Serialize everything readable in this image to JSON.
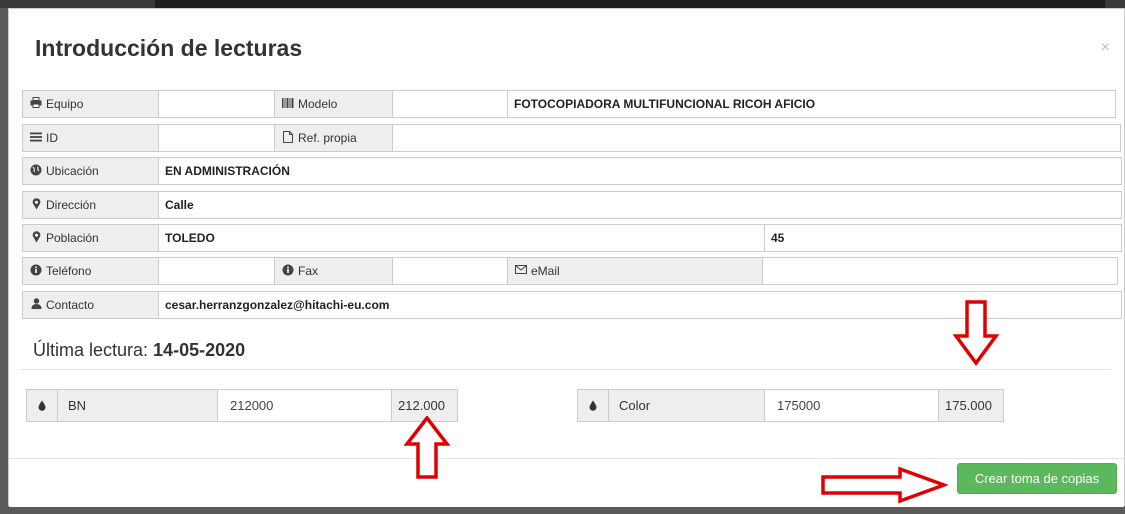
{
  "modal": {
    "title": "Introducción de lecturas",
    "close": "×"
  },
  "info": {
    "equipo": {
      "label": "Equipo",
      "value": ""
    },
    "modelo": {
      "label": "Modelo",
      "value": "",
      "description": "FOTOCOPIADORA MULTIFUNCIONAL RICOH AFICIO"
    },
    "id": {
      "label": "ID",
      "value": ""
    },
    "ref_propia": {
      "label": "Ref. propia",
      "value": ""
    },
    "ubicacion": {
      "label": "Ubicación",
      "value": "EN ADMINISTRACIÓN"
    },
    "direccion": {
      "label": "Dirección",
      "value": "Calle"
    },
    "poblacion": {
      "label": "Población",
      "value": "TOLEDO",
      "postal_code": "45"
    },
    "telefono": {
      "label": "Teléfono",
      "value": ""
    },
    "fax": {
      "label": "Fax",
      "value": ""
    },
    "email": {
      "label": "eMail",
      "value": ""
    },
    "contacto": {
      "label": "Contacto",
      "value": "cesar.herranzgonzalez@hitachi-eu.com"
    }
  },
  "last_reading": {
    "label": "Última lectura:",
    "date": "14-05-2020"
  },
  "readings": {
    "bn": {
      "icon": "●",
      "label": "BN",
      "value": "212000",
      "formatted": "212.000"
    },
    "color": {
      "icon": "●",
      "label": "Color",
      "value": "175000",
      "formatted": "175.000"
    }
  },
  "footer": {
    "create_button": "Crear toma de copias"
  },
  "icons": {
    "print": "print-icon",
    "barcode": "barcode-icon",
    "list": "list-icon",
    "file": "file-icon",
    "globe": "globe-icon",
    "marker": "map-marker-icon",
    "info": "info-circle-icon",
    "envelope": "envelope-icon",
    "user": "user-icon",
    "tint": "tint-icon"
  },
  "colors": {
    "button_green": "#5cb85c",
    "annotation_red": "#e00000"
  }
}
